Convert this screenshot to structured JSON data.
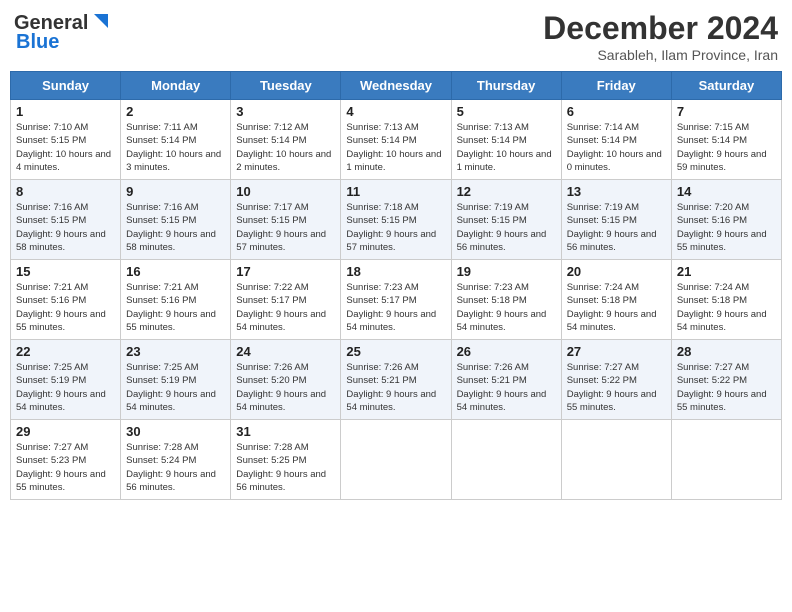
{
  "header": {
    "logo_general": "General",
    "logo_blue": "Blue",
    "month_title": "December 2024",
    "subtitle": "Sarableh, Ilam Province, Iran"
  },
  "days_of_week": [
    "Sunday",
    "Monday",
    "Tuesday",
    "Wednesday",
    "Thursday",
    "Friday",
    "Saturday"
  ],
  "weeks": [
    [
      {
        "day": "1",
        "sunrise": "Sunrise: 7:10 AM",
        "sunset": "Sunset: 5:15 PM",
        "daylight": "Daylight: 10 hours and 4 minutes."
      },
      {
        "day": "2",
        "sunrise": "Sunrise: 7:11 AM",
        "sunset": "Sunset: 5:14 PM",
        "daylight": "Daylight: 10 hours and 3 minutes."
      },
      {
        "day": "3",
        "sunrise": "Sunrise: 7:12 AM",
        "sunset": "Sunset: 5:14 PM",
        "daylight": "Daylight: 10 hours and 2 minutes."
      },
      {
        "day": "4",
        "sunrise": "Sunrise: 7:13 AM",
        "sunset": "Sunset: 5:14 PM",
        "daylight": "Daylight: 10 hours and 1 minute."
      },
      {
        "day": "5",
        "sunrise": "Sunrise: 7:13 AM",
        "sunset": "Sunset: 5:14 PM",
        "daylight": "Daylight: 10 hours and 1 minute."
      },
      {
        "day": "6",
        "sunrise": "Sunrise: 7:14 AM",
        "sunset": "Sunset: 5:14 PM",
        "daylight": "Daylight: 10 hours and 0 minutes."
      },
      {
        "day": "7",
        "sunrise": "Sunrise: 7:15 AM",
        "sunset": "Sunset: 5:14 PM",
        "daylight": "Daylight: 9 hours and 59 minutes."
      }
    ],
    [
      {
        "day": "8",
        "sunrise": "Sunrise: 7:16 AM",
        "sunset": "Sunset: 5:15 PM",
        "daylight": "Daylight: 9 hours and 58 minutes."
      },
      {
        "day": "9",
        "sunrise": "Sunrise: 7:16 AM",
        "sunset": "Sunset: 5:15 PM",
        "daylight": "Daylight: 9 hours and 58 minutes."
      },
      {
        "day": "10",
        "sunrise": "Sunrise: 7:17 AM",
        "sunset": "Sunset: 5:15 PM",
        "daylight": "Daylight: 9 hours and 57 minutes."
      },
      {
        "day": "11",
        "sunrise": "Sunrise: 7:18 AM",
        "sunset": "Sunset: 5:15 PM",
        "daylight": "Daylight: 9 hours and 57 minutes."
      },
      {
        "day": "12",
        "sunrise": "Sunrise: 7:19 AM",
        "sunset": "Sunset: 5:15 PM",
        "daylight": "Daylight: 9 hours and 56 minutes."
      },
      {
        "day": "13",
        "sunrise": "Sunrise: 7:19 AM",
        "sunset": "Sunset: 5:15 PM",
        "daylight": "Daylight: 9 hours and 56 minutes."
      },
      {
        "day": "14",
        "sunrise": "Sunrise: 7:20 AM",
        "sunset": "Sunset: 5:16 PM",
        "daylight": "Daylight: 9 hours and 55 minutes."
      }
    ],
    [
      {
        "day": "15",
        "sunrise": "Sunrise: 7:21 AM",
        "sunset": "Sunset: 5:16 PM",
        "daylight": "Daylight: 9 hours and 55 minutes."
      },
      {
        "day": "16",
        "sunrise": "Sunrise: 7:21 AM",
        "sunset": "Sunset: 5:16 PM",
        "daylight": "Daylight: 9 hours and 55 minutes."
      },
      {
        "day": "17",
        "sunrise": "Sunrise: 7:22 AM",
        "sunset": "Sunset: 5:17 PM",
        "daylight": "Daylight: 9 hours and 54 minutes."
      },
      {
        "day": "18",
        "sunrise": "Sunrise: 7:23 AM",
        "sunset": "Sunset: 5:17 PM",
        "daylight": "Daylight: 9 hours and 54 minutes."
      },
      {
        "day": "19",
        "sunrise": "Sunrise: 7:23 AM",
        "sunset": "Sunset: 5:18 PM",
        "daylight": "Daylight: 9 hours and 54 minutes."
      },
      {
        "day": "20",
        "sunrise": "Sunrise: 7:24 AM",
        "sunset": "Sunset: 5:18 PM",
        "daylight": "Daylight: 9 hours and 54 minutes."
      },
      {
        "day": "21",
        "sunrise": "Sunrise: 7:24 AM",
        "sunset": "Sunset: 5:18 PM",
        "daylight": "Daylight: 9 hours and 54 minutes."
      }
    ],
    [
      {
        "day": "22",
        "sunrise": "Sunrise: 7:25 AM",
        "sunset": "Sunset: 5:19 PM",
        "daylight": "Daylight: 9 hours and 54 minutes."
      },
      {
        "day": "23",
        "sunrise": "Sunrise: 7:25 AM",
        "sunset": "Sunset: 5:19 PM",
        "daylight": "Daylight: 9 hours and 54 minutes."
      },
      {
        "day": "24",
        "sunrise": "Sunrise: 7:26 AM",
        "sunset": "Sunset: 5:20 PM",
        "daylight": "Daylight: 9 hours and 54 minutes."
      },
      {
        "day": "25",
        "sunrise": "Sunrise: 7:26 AM",
        "sunset": "Sunset: 5:21 PM",
        "daylight": "Daylight: 9 hours and 54 minutes."
      },
      {
        "day": "26",
        "sunrise": "Sunrise: 7:26 AM",
        "sunset": "Sunset: 5:21 PM",
        "daylight": "Daylight: 9 hours and 54 minutes."
      },
      {
        "day": "27",
        "sunrise": "Sunrise: 7:27 AM",
        "sunset": "Sunset: 5:22 PM",
        "daylight": "Daylight: 9 hours and 55 minutes."
      },
      {
        "day": "28",
        "sunrise": "Sunrise: 7:27 AM",
        "sunset": "Sunset: 5:22 PM",
        "daylight": "Daylight: 9 hours and 55 minutes."
      }
    ],
    [
      {
        "day": "29",
        "sunrise": "Sunrise: 7:27 AM",
        "sunset": "Sunset: 5:23 PM",
        "daylight": "Daylight: 9 hours and 55 minutes."
      },
      {
        "day": "30",
        "sunrise": "Sunrise: 7:28 AM",
        "sunset": "Sunset: 5:24 PM",
        "daylight": "Daylight: 9 hours and 56 minutes."
      },
      {
        "day": "31",
        "sunrise": "Sunrise: 7:28 AM",
        "sunset": "Sunset: 5:25 PM",
        "daylight": "Daylight: 9 hours and 56 minutes."
      },
      null,
      null,
      null,
      null
    ]
  ]
}
